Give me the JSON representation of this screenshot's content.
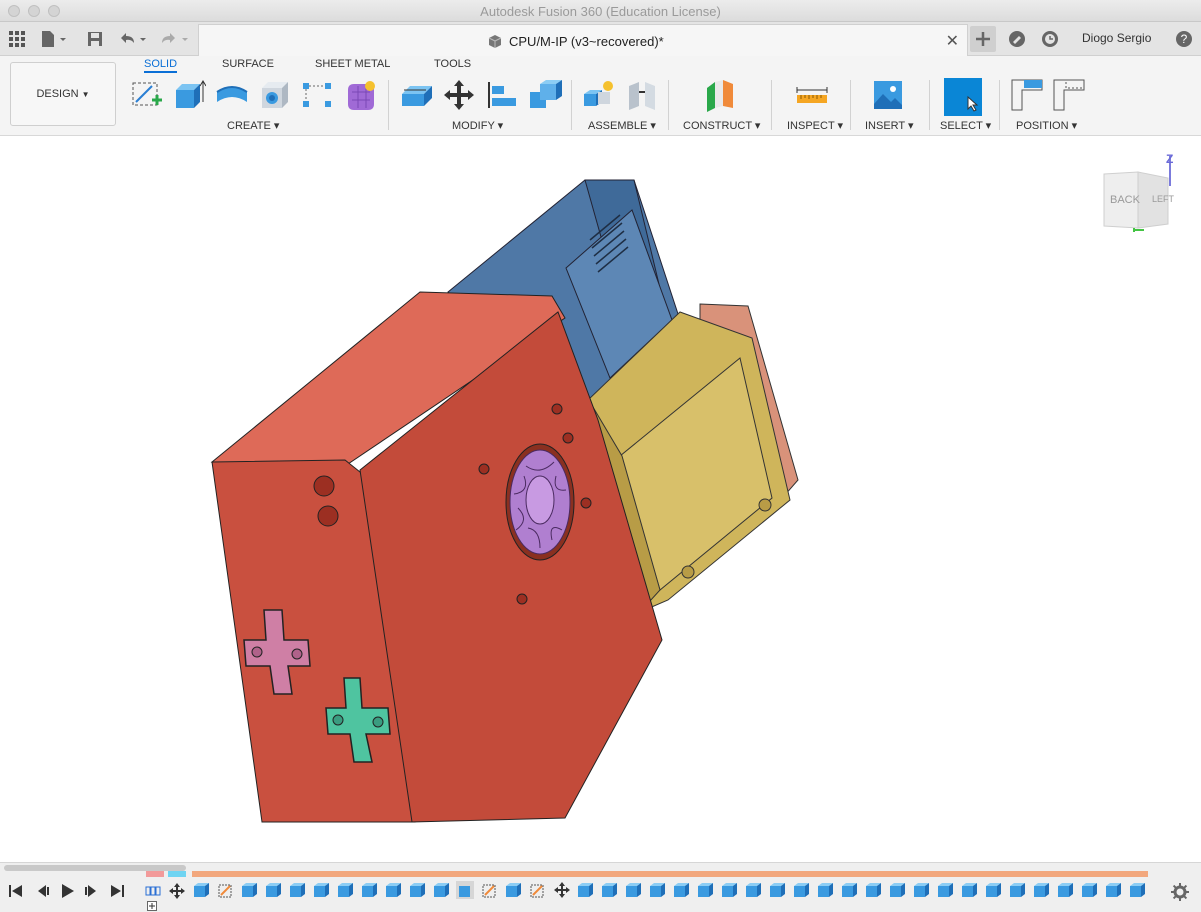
{
  "window": {
    "title": "Autodesk Fusion 360 (Education License)"
  },
  "document": {
    "title": "CPU/M-IP (v3~recovered)*"
  },
  "user": {
    "name": "Diogo Sergio"
  },
  "workspace": {
    "label": "DESIGN"
  },
  "tabs": [
    "SOLID",
    "SURFACE",
    "SHEET METAL",
    "TOOLS"
  ],
  "groups": {
    "create": "CREATE",
    "modify": "MODIFY",
    "assemble": "ASSEMBLE",
    "construct": "CONSTRUCT",
    "inspect": "INSPECT",
    "insert": "INSERT",
    "select": "SELECT",
    "position": "POSITION"
  },
  "viewcube": {
    "face_back": "BACK",
    "face_left": "LEFT",
    "axis": "Z"
  },
  "colors": {
    "body_red": "#c9503f",
    "body_red_top": "#de6a58",
    "board_blue": "#4f78a6",
    "card_yellow": "#cfb55b",
    "card_salmon": "#d9927a",
    "fan_purple": "#b07fd0",
    "dpad_pink": "#cf7fa5",
    "dpad_teal": "#4fc4a0",
    "accent_blue": "#0a86d6"
  },
  "icons": [
    "sketch-icon",
    "extrude-icon",
    "revolve-icon",
    "hole-icon",
    "pattern-icon",
    "form-icon",
    "press-pull-icon",
    "move-icon",
    "align-icon",
    "combine-icon",
    "new-component-icon",
    "joint-icon",
    "plane-icon",
    "measure-icon",
    "insert-image-icon",
    "select-box-icon",
    "position-icon"
  ]
}
